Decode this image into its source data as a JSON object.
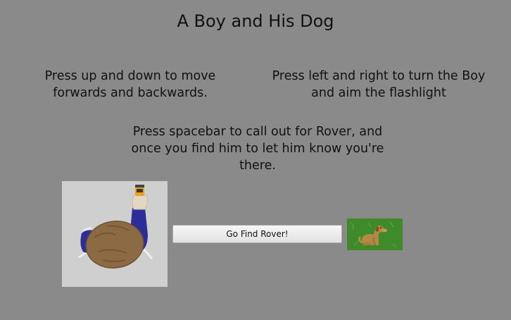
{
  "page": {
    "title": "A Boy and His Dog"
  },
  "instructions": {
    "move": "Press up and down to move forwards and backwards.",
    "turn": "Press left and right to turn the Boy and aim the flashlight",
    "call": "Press spacebar to call out for Rover, and once you find him to let him know you're there."
  },
  "start": {
    "button_label": "Go Find Rover!"
  },
  "colors": {
    "background": "#8a8a8a",
    "boy_hair": "#8b6a44",
    "boy_sleeve": "#2d2d9a",
    "grass": "#3f8a2b",
    "dog": "#b38a45"
  }
}
